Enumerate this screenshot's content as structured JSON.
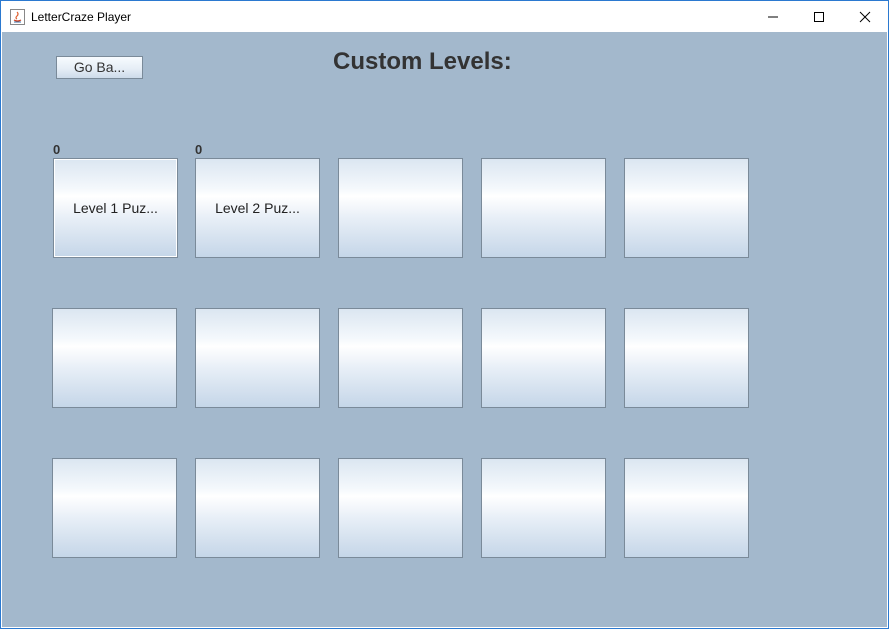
{
  "window": {
    "title": "LetterCraze Player",
    "controls": {
      "minimize": "minimize-icon",
      "maximize": "maximize-icon",
      "close": "close-icon"
    }
  },
  "header": {
    "back_label": "Go Ba...",
    "title": "Custom Levels:"
  },
  "levels": {
    "scores": [
      "0",
      "0"
    ],
    "buttons": [
      "Level 1 Puz...",
      "Level 2 Puz...",
      "",
      "",
      "",
      "",
      "",
      "",
      "",
      "",
      "",
      "",
      "",
      "",
      ""
    ]
  },
  "colors": {
    "background": "#a3b8cc",
    "border": "#7a8a99",
    "accent_border": "#2b79d0"
  }
}
